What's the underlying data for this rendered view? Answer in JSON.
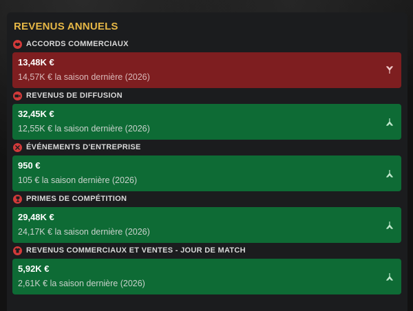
{
  "panel": {
    "title": "REVENUS ANNUELS"
  },
  "colors": {
    "title_accent": "#e7b846",
    "decrease_bg": "#7e1e20",
    "increase_bg": "#0e6b35",
    "section_icon": "#d23a3a",
    "panel_bg": "#1b1c1e"
  },
  "sections": [
    {
      "title": "ACCORDS COMMERCIAUX",
      "icon": "handshake-icon",
      "value": "13,48K €",
      "previous": "14,57K € la saison dernière (2026)",
      "trend": "down"
    },
    {
      "title": "REVENUS DE DIFFUSION",
      "icon": "broadcast-camera-icon",
      "value": "32,45K €",
      "previous": "12,55K € la saison dernière (2026)",
      "trend": "up"
    },
    {
      "title": "ÉVÉNEMENTS D'ENTREPRISE",
      "icon": "cutlery-icon",
      "value": "950 €",
      "previous": "105 € la saison dernière (2026)",
      "trend": "up"
    },
    {
      "title": "PRIMES DE COMPÉTITION",
      "icon": "trophy-icon",
      "value": "29,48K €",
      "previous": "24,17K € la saison dernière (2026)",
      "trend": "up"
    },
    {
      "title": "REVENUS COMMERCIAUX ET VENTES - JOUR DE MATCH",
      "icon": "shirt-icon",
      "value": "5,92K €",
      "previous": "2,61K € la saison dernière (2026)",
      "trend": "up"
    }
  ]
}
